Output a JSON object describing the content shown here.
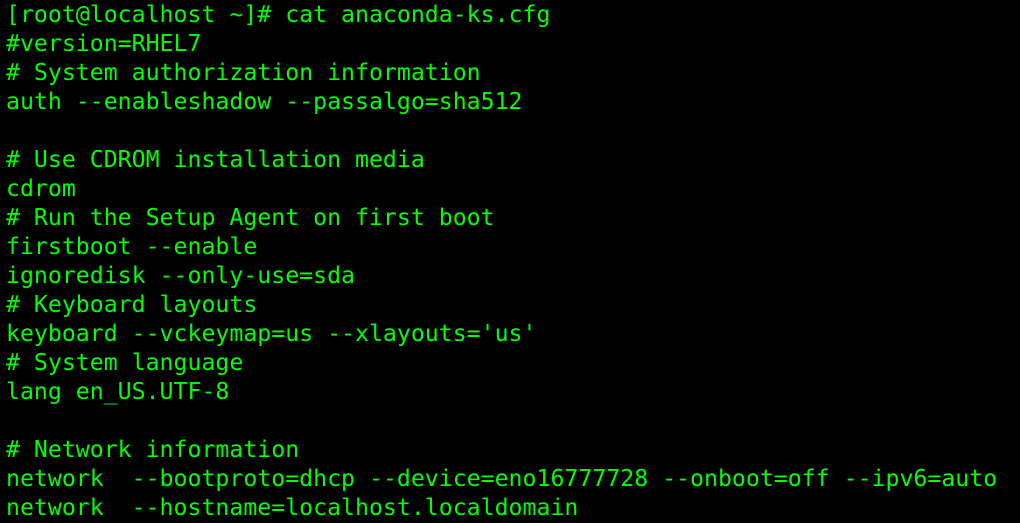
{
  "terminal": {
    "prompt": "[root@localhost ~]# ",
    "command": "cat anaconda-ks.cfg",
    "text_color": "#00ff00",
    "background_color": "#000000",
    "lines": [
      "#version=RHEL7",
      "# System authorization information",
      "auth --enableshadow --passalgo=sha512",
      "",
      "# Use CDROM installation media",
      "cdrom",
      "# Run the Setup Agent on first boot",
      "firstboot --enable",
      "ignoredisk --only-use=sda",
      "# Keyboard layouts",
      "keyboard --vckeymap=us --xlayouts='us'",
      "# System language",
      "lang en_US.UTF-8",
      "",
      "# Network information",
      "network  --bootproto=dhcp --device=eno16777728 --onboot=off --ipv6=auto",
      "network  --hostname=localhost.localdomain"
    ]
  }
}
